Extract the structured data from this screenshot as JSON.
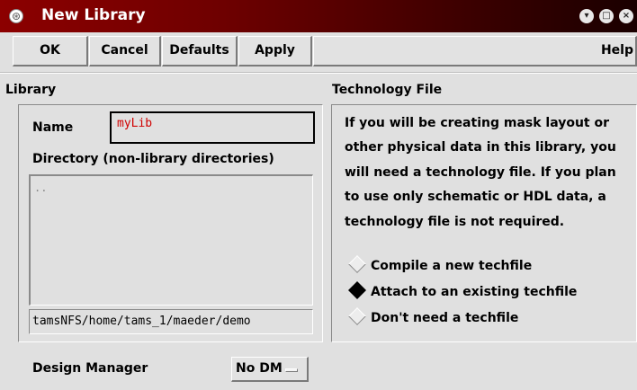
{
  "window": {
    "title": "New Library",
    "controls": {
      "minimize_icon": "▾",
      "maximize_icon": "□",
      "close_icon": "×"
    }
  },
  "toolbar": {
    "ok_label": "OK",
    "cancel_label": "Cancel",
    "defaults_label": "Defaults",
    "apply_label": "Apply",
    "help_label": "Help"
  },
  "library": {
    "header": "Library",
    "name_label": "Name",
    "name_value": "myLib",
    "directory_label": "Directory (non-library directories)",
    "directory_items": [
      ".."
    ],
    "path_value": "tamsNFS/home/tams_1/maeder/demo"
  },
  "technology": {
    "header": "Technology File",
    "description_lines": [
      "If you will be creating mask layout or",
      "other physical data in this library, you",
      "will need a technology file. If you plan",
      "to use only schematic or HDL data, a",
      "technology file is not required."
    ],
    "options": [
      {
        "label": "Compile a new techfile",
        "selected": false
      },
      {
        "label": "Attach to an existing techfile",
        "selected": true
      },
      {
        "label": "Don't need a techfile",
        "selected": false
      }
    ]
  },
  "design_manager": {
    "label": "Design Manager",
    "value": "No DM"
  },
  "colors": {
    "title_bar": "#8c0000",
    "background": "#e0e0e0",
    "name_text": "#d00000"
  }
}
